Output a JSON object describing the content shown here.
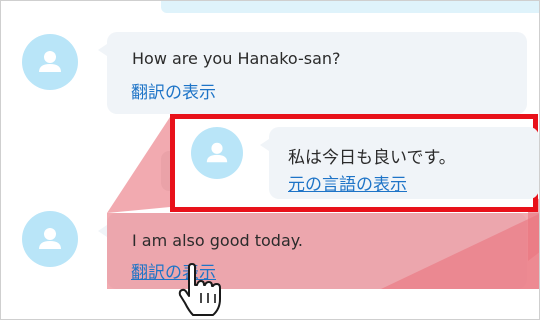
{
  "messages": [
    {
      "text": "How are you Hanako-san?",
      "link": "翻訳の表示"
    },
    {
      "text": "I am also good today.",
      "link": "翻訳の表示"
    }
  ],
  "callout": {
    "text": "私は今日も良いです。",
    "link": "元の言語の表示"
  },
  "colors": {
    "accent_link": "#1e74c7",
    "avatar": "#b9e5f8",
    "bubble": "#f0f4f8",
    "highlight": "#ea7680",
    "callout_border": "#e8111a"
  },
  "icons": [
    "user-avatar-icon",
    "pointer-hand-icon"
  ]
}
